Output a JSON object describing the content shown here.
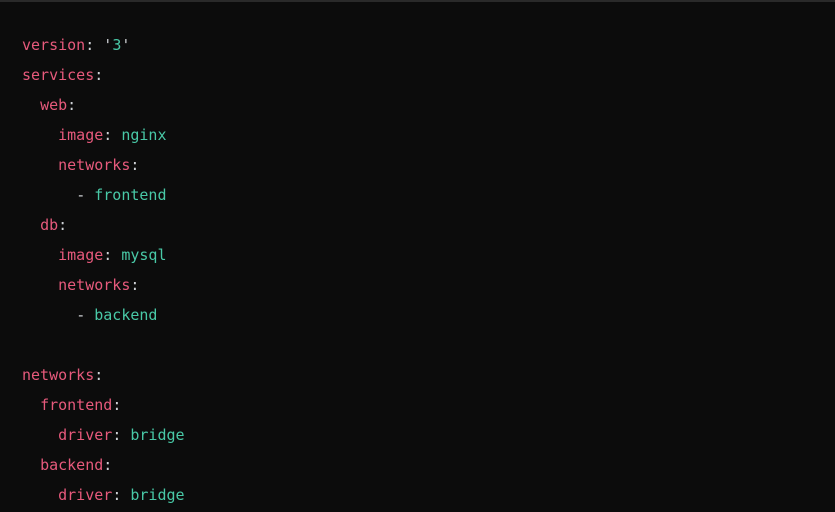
{
  "yaml": {
    "version_key": "version",
    "version_val": "3",
    "services_key": "services",
    "web_key": "web",
    "web_image_key": "image",
    "web_image_val": "nginx",
    "web_networks_key": "networks",
    "web_networks_item": "frontend",
    "db_key": "db",
    "db_image_key": "image",
    "db_image_val": "mysql",
    "db_networks_key": "networks",
    "db_networks_item": "backend",
    "networks_key": "networks",
    "frontend_key": "frontend",
    "frontend_driver_key": "driver",
    "frontend_driver_val": "bridge",
    "backend_key": "backend",
    "backend_driver_key": "driver",
    "backend_driver_val": "bridge"
  },
  "glyph": {
    "colon": ":",
    "dash": "-",
    "sq": "'"
  }
}
